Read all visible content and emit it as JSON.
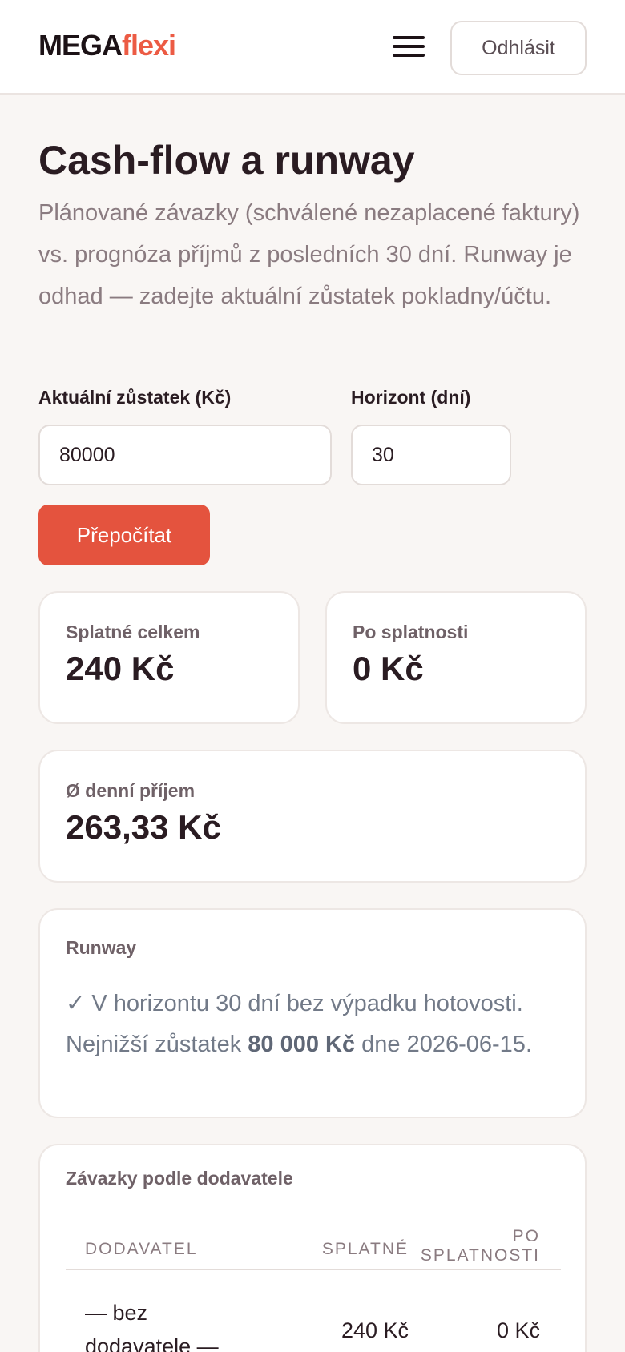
{
  "header": {
    "logo_part1": "MEGA",
    "logo_part2": "flexi",
    "menu_icon": "hamburger-icon",
    "logout_label": "Odhlásit"
  },
  "page": {
    "title": "Cash-flow a runway",
    "description": "Plánované závazky (schválené nezaplacené faktury) vs. prognóza příjmů z posledních 30 dní. Runway je odhad — zadejte aktuální zůstatek pokladny/účtu."
  },
  "form": {
    "balance_label": "Aktuální zůstatek (Kč)",
    "balance_value": "80000",
    "horizon_label": "Horizont (dní)",
    "horizon_value": "30",
    "recalc_label": "Přepočítat"
  },
  "stats": {
    "due_total_label": "Splatné celkem",
    "due_total_value": "240 Kč",
    "overdue_label": "Po splatnosti",
    "overdue_value": "0 Kč",
    "daily_income_label": "Ø denní příjem",
    "daily_income_value": "263,33 Kč"
  },
  "runway": {
    "label": "Runway",
    "text_before": "✓ V horizontu 30 dní bez výpadku hotovosti. Nejnižší zůstatek ",
    "lowest_balance": "80 000 Kč",
    "text_middle": " dne ",
    "date": "2026-06-15",
    "text_after": "."
  },
  "suppliers_table": {
    "title": "Závazky podle dodavatele",
    "columns": [
      "DODAVATEL",
      "SPLATNÉ",
      "PO SPLATNOSTI"
    ],
    "rows": [
      {
        "supplier": "— bez dodavatele —",
        "due": "240 Kč",
        "overdue": "0 Kč"
      }
    ]
  },
  "colors": {
    "accent": "#e4533e",
    "logo_accent": "#ec5b44",
    "background": "#f9f6f4"
  }
}
